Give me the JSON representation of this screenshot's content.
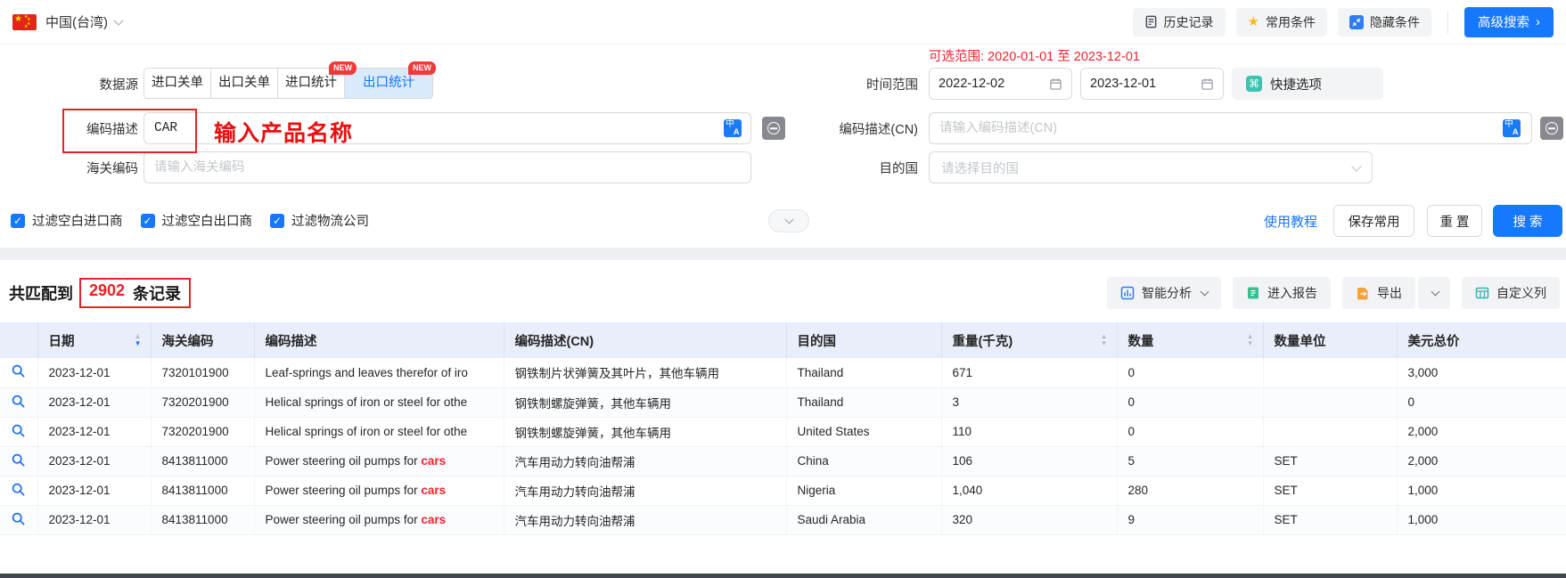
{
  "topbar": {
    "country": "中国(台湾)",
    "history_button": "历史记录",
    "favorites_button": "常用条件",
    "hide_conditions_button": "隐藏条件",
    "advanced_search_button": "高级搜索",
    "advanced_search_arrow": "›"
  },
  "filters": {
    "datasource_label": "数据源",
    "tabs": [
      {
        "label": "进口关单",
        "badge": "",
        "active": false
      },
      {
        "label": "出口关单",
        "badge": "",
        "active": false
      },
      {
        "label": "进口统计",
        "badge": "NEW",
        "active": false
      },
      {
        "label": "出口统计",
        "badge": "NEW",
        "active": true
      }
    ],
    "range_hint": "可选范围: 2020-01-01 至 2023-12-01",
    "time_range_label": "时间范围",
    "date_from": "2022-12-02",
    "date_to": "2023-12-01",
    "quick_options_button": "快捷选项",
    "desc_label": "编码描述",
    "desc_value": "CAR",
    "annotation_text": "输入产品名称",
    "desc_cn_label": "编码描述(CN)",
    "desc_cn_placeholder": "请输入编码描述(CN)",
    "hs_code_label": "海关编码",
    "hs_code_placeholder": "请输入海关编码",
    "destination_label": "目的国",
    "destination_placeholder": "请选择目的国",
    "filter_blank_importer": "过滤空白进口商",
    "filter_blank_exporter": "过滤空白出口商",
    "filter_logistics": "过滤物流公司",
    "tutorial_link": "使用教程",
    "save_button": "保存常用",
    "reset_button": "重 置",
    "search_button": "搜 索"
  },
  "results": {
    "count_prefix": "共匹配到",
    "count": "2902",
    "count_suffix": "条记录",
    "smart_analysis_button": "智能分析",
    "report_button": "进入报告",
    "export_button": "导出",
    "custom_columns_button": "自定义列"
  },
  "table": {
    "headers": [
      {
        "label": "日期",
        "sortable": true,
        "active_sort": "desc"
      },
      {
        "label": "海关编码",
        "sortable": false
      },
      {
        "label": "编码描述",
        "sortable": false
      },
      {
        "label": "编码描述(CN)",
        "sortable": false
      },
      {
        "label": "目的国",
        "sortable": false
      },
      {
        "label": "重量(千克)",
        "sortable": true
      },
      {
        "label": "数量",
        "sortable": true
      },
      {
        "label": "数量单位",
        "sortable": false
      },
      {
        "label": "美元总价",
        "sortable": false
      }
    ],
    "rows": [
      {
        "date": "2023-12-01",
        "hs_code": "7320101900",
        "desc": "Leaf-springs and leaves therefor of iro",
        "desc_highlight": "",
        "desc_cn": "钢铁制片状弹簧及其叶片，其他车辆用",
        "destination": "Thailand",
        "weight": "671",
        "quantity": "0",
        "unit": "",
        "usd_total": "3,000"
      },
      {
        "date": "2023-12-01",
        "hs_code": "7320201900",
        "desc": "Helical springs of iron or steel for othe",
        "desc_highlight": "",
        "desc_cn": "钢铁制螺旋弹簧，其他车辆用",
        "destination": "Thailand",
        "weight": "3",
        "quantity": "0",
        "unit": "",
        "usd_total": "0"
      },
      {
        "date": "2023-12-01",
        "hs_code": "7320201900",
        "desc": "Helical springs of iron or steel for othe",
        "desc_highlight": "",
        "desc_cn": "钢铁制螺旋弹簧，其他车辆用",
        "destination": "United States",
        "weight": "110",
        "quantity": "0",
        "unit": "",
        "usd_total": "2,000"
      },
      {
        "date": "2023-12-01",
        "hs_code": "8413811000",
        "desc": "Power steering oil pumps for ",
        "desc_highlight": "cars",
        "desc_cn": "汽车用动力转向油帮浦",
        "destination": "China",
        "weight": "106",
        "quantity": "5",
        "unit": "SET",
        "usd_total": "2,000"
      },
      {
        "date": "2023-12-01",
        "hs_code": "8413811000",
        "desc": "Power steering oil pumps for ",
        "desc_highlight": "cars",
        "desc_cn": "汽车用动力转向油帮浦",
        "destination": "Nigeria",
        "weight": "1,040",
        "quantity": "280",
        "unit": "SET",
        "usd_total": "1,000"
      },
      {
        "date": "2023-12-01",
        "hs_code": "8413811000",
        "desc": "Power steering oil pumps for ",
        "desc_highlight": "cars",
        "desc_cn": "汽车用动力转向油帮浦",
        "destination": "Saudi Arabia",
        "weight": "320",
        "quantity": "9",
        "unit": "SET",
        "usd_total": "1,000"
      }
    ]
  },
  "colors": {
    "primary_blue": "#1677ff",
    "annotation_red": "#ed1f24",
    "keyword_red": "#f5222d",
    "checkbox_blue": "#1677ff"
  }
}
